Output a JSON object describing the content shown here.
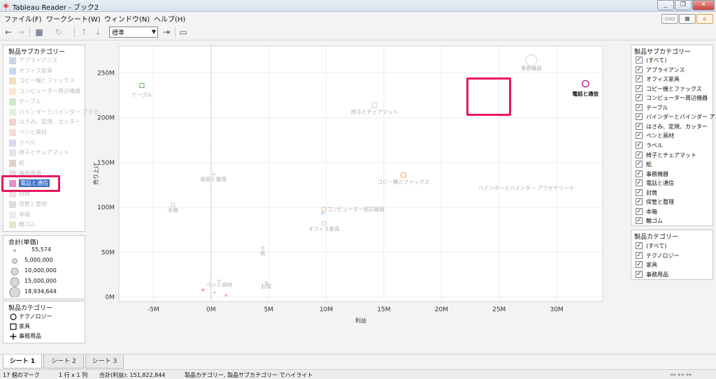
{
  "window": {
    "title": "Tableau Reader - ブック2"
  },
  "menu": [
    "ファイル(F)",
    "ワークシート(W)",
    "ウィンドウ(N)",
    "ヘルプ(H)"
  ],
  "toolbar": {
    "fit_value": "標準"
  },
  "left_panel": {
    "color_legend": {
      "title": "製品サブカテゴリー",
      "items": [
        {
          "label": "アプライアンス",
          "color": "#c9d4e6"
        },
        {
          "label": "オフィス家具",
          "color": "#c8d9ee"
        },
        {
          "label": "コピー機とファックス",
          "color": "#f6ddbd"
        },
        {
          "label": "コンピューター周辺機器",
          "color": "#fbe6cf"
        },
        {
          "label": "テーブル",
          "color": "#cfe8c8"
        },
        {
          "label": "バインダーとバインダー アクセ...",
          "color": "#e3f1dc"
        },
        {
          "label": "はさみ、定規、カッター",
          "color": "#f5d1d0"
        },
        {
          "label": "ペンと画材",
          "color": "#f8dcdc"
        },
        {
          "label": "ラベル",
          "color": "#ddd4ea"
        },
        {
          "label": "椅子とチェアマット",
          "color": "#e7e2ef"
        },
        {
          "label": "紙",
          "color": "#dcd1cb"
        },
        {
          "label": "事務機器",
          "color": "#e8dfdb"
        },
        {
          "label": "電話と通信",
          "color": "#e58fc9"
        },
        {
          "label": "封筒",
          "color": "#f0dcea"
        },
        {
          "label": "保管と整理",
          "color": "#dcdcdc"
        },
        {
          "label": "本箱",
          "color": "#ececec"
        },
        {
          "label": "輪ゴム",
          "color": "#e4e9c8"
        }
      ]
    },
    "size_legend": {
      "title": "合計(単価)",
      "items": [
        "55,574",
        "5,000,000",
        "10,000,000",
        "15,000,000",
        "18,934,644"
      ]
    },
    "shape_legend": {
      "title": "製品カテゴリー",
      "items": [
        {
          "label": "テクノロジー",
          "shape": "circle"
        },
        {
          "label": "家具",
          "shape": "square"
        },
        {
          "label": "事務用品",
          "shape": "plus"
        }
      ]
    }
  },
  "chart_data": {
    "type": "scatter",
    "xlabel": "利益",
    "ylabel": "売り上げ",
    "x_ticks": [
      "-5M",
      "0M",
      "5M",
      "10M",
      "15M",
      "20M",
      "25M",
      "30M"
    ],
    "y_ticks": [
      "0M",
      "50M",
      "100M",
      "150M",
      "200M",
      "250M"
    ],
    "xlim": [
      -8.0,
      34.0
    ],
    "ylim": [
      -5,
      280
    ],
    "highlight": "電話と通信",
    "points": [
      {
        "label": "事務機器",
        "x": 27.8,
        "y": 264,
        "shape": "circle",
        "size": 18.9,
        "color": "#dcdcdc"
      },
      {
        "label": "電話と通信",
        "x": 32.5,
        "y": 238,
        "shape": "circle",
        "size": 11,
        "color": "#c2188d"
      },
      {
        "label": "テーブル",
        "x": -6.0,
        "y": 236,
        "shape": "square",
        "size": 6,
        "color": "#6ab36a"
      },
      {
        "label": "椅子とチェアマット",
        "x": 14.2,
        "y": 214,
        "shape": "square",
        "size": 7,
        "color": "#d4d4d4"
      },
      {
        "label": "コピー機とファックス",
        "x": 16.7,
        "y": 136,
        "shape": "circle",
        "size": 9,
        "color": "#f0b060"
      },
      {
        "label": "バインダーとバインダー アクセサリー",
        "x": 31.3,
        "y": 122,
        "shape": "plus",
        "size": 6,
        "color": "#cfcfcf"
      },
      {
        "label": "保管と整理",
        "x": 0.2,
        "y": 137,
        "shape": "plus",
        "size": 6,
        "color": "#cfcfcf"
      },
      {
        "label": "本箱",
        "x": -3.3,
        "y": 103,
        "shape": "square",
        "size": 5,
        "color": "#d4d4d4"
      },
      {
        "label": "コンピューター周辺機器",
        "x": 9.8,
        "y": 98,
        "shape": "circle",
        "size": 7,
        "color": "#f3c890"
      },
      {
        "label": "オフィス家具",
        "x": 9.8,
        "y": 82,
        "shape": "square",
        "size": 5,
        "color": "#d4d4d4"
      },
      {
        "label": "アプライアンス",
        "x": 9.7,
        "y": 94,
        "shape": "plus",
        "size": 5,
        "color": "#b8c4de"
      },
      {
        "label": "紙",
        "x": 4.5,
        "y": 55,
        "shape": "plus",
        "size": 5,
        "color": "#cfcfcf"
      },
      {
        "label": "封筒",
        "x": 4.8,
        "y": 16,
        "shape": "plus",
        "size": 4,
        "color": "#cfcfcf"
      },
      {
        "label": "ペンと画材",
        "x": 0.7,
        "y": 18,
        "shape": "plus",
        "size": 4,
        "color": "#cfcfcf"
      },
      {
        "label": "はさみ、定規、カッター",
        "x": -0.7,
        "y": 8,
        "shape": "plus",
        "size": 3,
        "color": "#f08080"
      },
      {
        "label": "ラベル",
        "x": 1.3,
        "y": 2,
        "shape": "plus",
        "size": 2,
        "color": "#f08080"
      },
      {
        "label": "輪ゴム",
        "x": 0.3,
        "y": 5,
        "shape": "plus",
        "size": 2,
        "color": "#e0c0c0"
      }
    ]
  },
  "right_panel": {
    "subcat_filter": {
      "title": "製品サブカテゴリー",
      "items": [
        "(すべて)",
        "アプライアンス",
        "オフィス家具",
        "コピー機とファックス",
        "コンピューター周辺機器",
        "テーブル",
        "バインダーとバインダー ア...",
        "はさみ、定規、カッター",
        "ペンと画材",
        "ラベル",
        "椅子とチェアマット",
        "紙",
        "事務機器",
        "電話と通信",
        "封筒",
        "保管と整理",
        "本箱",
        "輪ゴム"
      ]
    },
    "cat_filter": {
      "title": "製品カテゴリー",
      "items": [
        "(すべて)",
        "テクノロジー",
        "家具",
        "事務用品"
      ]
    }
  },
  "tabs": [
    "シート 1",
    "シート 2",
    "シート 3"
  ],
  "status": {
    "marks": "17 個のマーク",
    "grid": "1 行 x 1 列",
    "sum": "合計(利益): 151,822,844",
    "highlight": "製品カテゴリー, 製品サブカテゴリー でハイライト"
  }
}
